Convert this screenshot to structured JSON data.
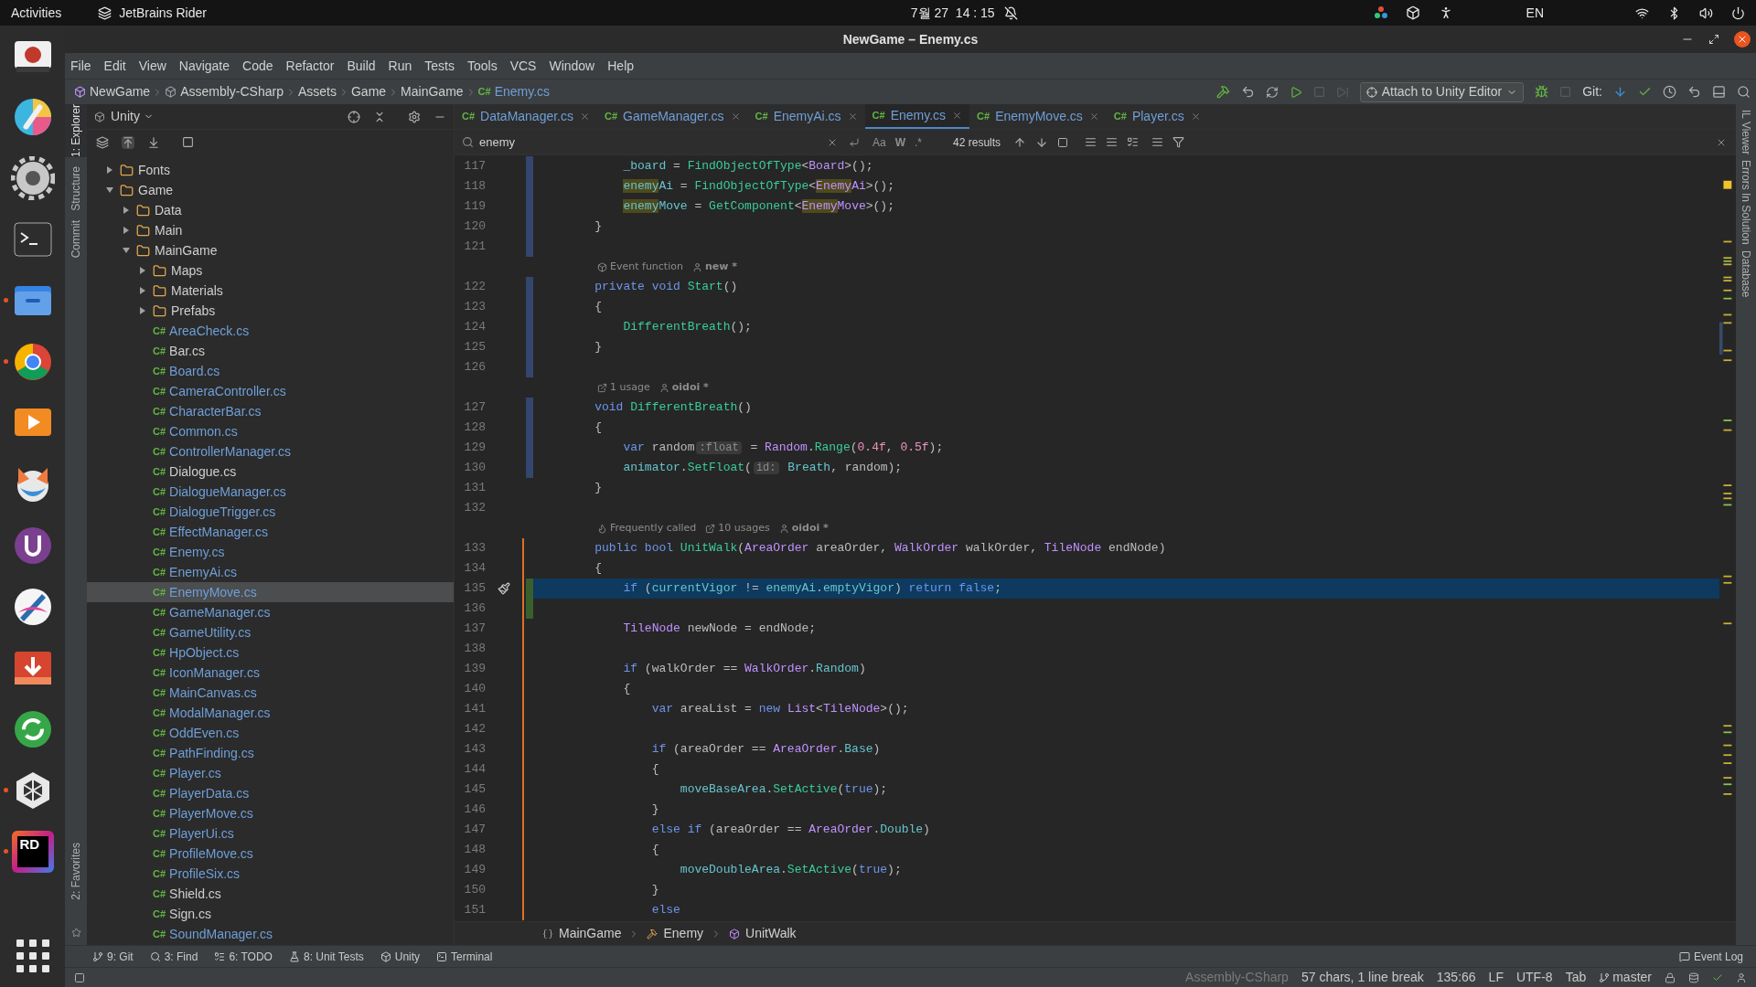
{
  "top_bar": {
    "activities": "Activities",
    "app_name": "JetBrains Rider",
    "clock": "7월 27  14 : 15",
    "language": "EN"
  },
  "dock": [
    {
      "kind": "screenshot",
      "running": false
    },
    {
      "kind": "colorpicker",
      "running": false
    },
    {
      "kind": "settings",
      "running": false
    },
    {
      "kind": "terminal",
      "running": false
    },
    {
      "kind": "files",
      "running": true
    },
    {
      "kind": "browser",
      "running": true
    },
    {
      "kind": "player",
      "running": false
    },
    {
      "kind": "fox",
      "running": false
    },
    {
      "kind": "ulauncher",
      "running": false
    },
    {
      "kind": "pen",
      "running": false
    },
    {
      "kind": "download",
      "running": false
    },
    {
      "kind": "sync",
      "running": false
    },
    {
      "kind": "unity",
      "running": true
    },
    {
      "kind": "rider",
      "running": true,
      "label": "RD"
    }
  ],
  "window": {
    "title": "NewGame – Enemy.cs"
  },
  "menu": [
    "File",
    "Edit",
    "View",
    "Navigate",
    "Code",
    "Refactor",
    "Build",
    "Run",
    "Tests",
    "Tools",
    "VCS",
    "Window",
    "Help"
  ],
  "nav_path": [
    {
      "label": "NewGame"
    },
    {
      "label": "Assembly-CSharp"
    },
    {
      "label": "Assets"
    },
    {
      "label": "Game"
    },
    {
      "label": "MainGame"
    },
    {
      "label": "Enemy.cs",
      "badge": "C#"
    }
  ],
  "run_config": "Attach to Unity Editor",
  "git_label": "Git:",
  "left_strip": [
    {
      "label": "1: Explorer",
      "selected": true
    },
    {
      "label": "Structure",
      "selected": false
    },
    {
      "label": "Commit",
      "selected": false
    }
  ],
  "left_strip_bottom": "2: Favorites",
  "project": {
    "view": "Unity",
    "tree": [
      {
        "name": "Fonts",
        "kind": "folder",
        "expanded": false,
        "selected": false
      },
      {
        "name": "Game",
        "kind": "folder",
        "expanded": true,
        "selected": false,
        "children": [
          {
            "name": "Data",
            "kind": "folder",
            "expanded": false,
            "selected": false
          },
          {
            "name": "Main",
            "kind": "folder",
            "expanded": false,
            "selected": false
          },
          {
            "name": "MainGame",
            "kind": "folder",
            "expanded": true,
            "selected": false,
            "children": [
              {
                "name": "Maps",
                "kind": "folder",
                "expanded": false,
                "selected": false
              },
              {
                "name": "Materials",
                "kind": "folder",
                "expanded": false,
                "selected": false
              },
              {
                "name": "Prefabs",
                "kind": "folder",
                "expanded": false,
                "selected": false
              },
              {
                "name": "AreaCheck.cs",
                "kind": "file",
                "badge": "C#",
                "modified": true,
                "selected": false
              },
              {
                "name": "Bar.cs",
                "kind": "file",
                "badge": "C#",
                "modified": false,
                "selected": false
              },
              {
                "name": "Board.cs",
                "kind": "file",
                "badge": "C#",
                "modified": true,
                "selected": false
              },
              {
                "name": "CameraController.cs",
                "kind": "file",
                "badge": "C#",
                "modified": true,
                "selected": false
              },
              {
                "name": "CharacterBar.cs",
                "kind": "file",
                "badge": "C#",
                "modified": true,
                "selected": false
              },
              {
                "name": "Common.cs",
                "kind": "file",
                "badge": "C#",
                "modified": true,
                "selected": false
              },
              {
                "name": "ControllerManager.cs",
                "kind": "file",
                "badge": "C#",
                "modified": true,
                "selected": false
              },
              {
                "name": "Dialogue.cs",
                "kind": "file",
                "badge": "C#",
                "modified": false,
                "selected": false
              },
              {
                "name": "DialogueManager.cs",
                "kind": "file",
                "badge": "C#",
                "modified": true,
                "selected": false
              },
              {
                "name": "DialogueTrigger.cs",
                "kind": "file",
                "badge": "C#",
                "modified": true,
                "selected": false
              },
              {
                "name": "EffectManager.cs",
                "kind": "file",
                "badge": "C#",
                "modified": true,
                "selected": false
              },
              {
                "name": "Enemy.cs",
                "kind": "file",
                "badge": "C#",
                "modified": true,
                "selected": false
              },
              {
                "name": "EnemyAi.cs",
                "kind": "file",
                "badge": "C#",
                "modified": true,
                "selected": false
              },
              {
                "name": "EnemyMove.cs",
                "kind": "file",
                "badge": "C#",
                "modified": true,
                "selected": true
              },
              {
                "name": "GameManager.cs",
                "kind": "file",
                "badge": "C#",
                "modified": true,
                "selected": false
              },
              {
                "name": "GameUtility.cs",
                "kind": "file",
                "badge": "C#",
                "modified": true,
                "selected": false
              },
              {
                "name": "HpObject.cs",
                "kind": "file",
                "badge": "C#",
                "modified": true,
                "selected": false
              },
              {
                "name": "IconManager.cs",
                "kind": "file",
                "badge": "C#",
                "modified": true,
                "selected": false
              },
              {
                "name": "MainCanvas.cs",
                "kind": "file",
                "badge": "C#",
                "modified": true,
                "selected": false
              },
              {
                "name": "ModalManager.cs",
                "kind": "file",
                "badge": "C#",
                "modified": true,
                "selected": false
              },
              {
                "name": "OddEven.cs",
                "kind": "file",
                "badge": "C#",
                "modified": true,
                "selected": false
              },
              {
                "name": "PathFinding.cs",
                "kind": "file",
                "badge": "C#",
                "modified": true,
                "selected": false
              },
              {
                "name": "Player.cs",
                "kind": "file",
                "badge": "C#",
                "modified": true,
                "selected": false
              },
              {
                "name": "PlayerData.cs",
                "kind": "file",
                "badge": "C#",
                "modified": true,
                "selected": false
              },
              {
                "name": "PlayerMove.cs",
                "kind": "file",
                "badge": "C#",
                "modified": true,
                "selected": false
              },
              {
                "name": "PlayerUi.cs",
                "kind": "file",
                "badge": "C#",
                "modified": true,
                "selected": false
              },
              {
                "name": "ProfileMove.cs",
                "kind": "file",
                "badge": "C#",
                "modified": true,
                "selected": false
              },
              {
                "name": "ProfileSix.cs",
                "kind": "file",
                "badge": "C#",
                "modified": true,
                "selected": false
              },
              {
                "name": "Shield.cs",
                "kind": "file",
                "badge": "C#",
                "modified": false,
                "selected": false
              },
              {
                "name": "Sign.cs",
                "kind": "file",
                "badge": "C#",
                "modified": false,
                "selected": false
              },
              {
                "name": "SoundManager.cs",
                "kind": "file",
                "badge": "C#",
                "modified": true,
                "selected": false
              }
            ]
          }
        ]
      }
    ]
  },
  "tabs": [
    {
      "badge": "C#",
      "label": "DataManager.cs",
      "selected": false
    },
    {
      "badge": "C#",
      "label": "GameManager.cs",
      "selected": false
    },
    {
      "badge": "C#",
      "label": "EnemyAi.cs",
      "selected": false
    },
    {
      "badge": "C#",
      "label": "Enemy.cs",
      "selected": true
    },
    {
      "badge": "C#",
      "label": "EnemyMove.cs",
      "selected": false
    },
    {
      "badge": "C#",
      "label": "Player.cs",
      "selected": false
    }
  ],
  "search": {
    "value": "enemy",
    "match_case": "Aa",
    "words": "W",
    "regex": ".*",
    "results": "42 results"
  },
  "code": [
    {
      "number": "117",
      "current": false,
      "modified": true,
      "tokens": [
        {
          "text": "        _board",
          "kind": "field"
        },
        {
          "text": " = ",
          "kind": "plain"
        },
        {
          "text": "FindObjectOfType",
          "kind": "method"
        },
        {
          "text": "<",
          "kind": "plain"
        },
        {
          "text": "Board",
          "kind": "type"
        },
        {
          "text": ">();",
          "kind": "plain"
        }
      ]
    },
    {
      "number": "118",
      "current": false,
      "modified": true,
      "tokens": [
        {
          "text": "        enemy",
          "kind": "field",
          "match": true
        },
        {
          "text": "Ai",
          "kind": "field"
        },
        {
          "text": " = ",
          "kind": "plain"
        },
        {
          "text": "FindObjectOfType",
          "kind": "method"
        },
        {
          "text": "<",
          "kind": "plain"
        },
        {
          "text": "Enemy",
          "kind": "type",
          "match": true
        },
        {
          "text": "Ai",
          "kind": "type"
        },
        {
          "text": ">();",
          "kind": "plain"
        }
      ]
    },
    {
      "number": "119",
      "current": false,
      "modified": true,
      "tokens": [
        {
          "text": "        enemy",
          "kind": "field",
          "match": true
        },
        {
          "text": "Move",
          "kind": "field"
        },
        {
          "text": " = ",
          "kind": "plain"
        },
        {
          "text": "GetComponent",
          "kind": "method"
        },
        {
          "text": "<",
          "kind": "plain"
        },
        {
          "text": "Enemy",
          "kind": "type",
          "match": true
        },
        {
          "text": "Move",
          "kind": "type"
        },
        {
          "text": ">();",
          "kind": "plain"
        }
      ]
    },
    {
      "number": "120",
      "current": false,
      "modified": true,
      "tokens": [
        {
          "text": "    }",
          "kind": "plain"
        }
      ]
    },
    {
      "number": "121",
      "current": false,
      "modified": true
    },
    {
      "hints": [
        {
          "kind": "unity",
          "text": "Event function"
        },
        {
          "kind": "author",
          "text": "new *"
        }
      ]
    },
    {
      "number": "122",
      "current": false,
      "modified": true,
      "tokens": [
        {
          "text": "    private void",
          "kind": "keyword"
        },
        {
          "text": " Start",
          "kind": "method"
        },
        {
          "text": "()",
          "kind": "plain"
        }
      ]
    },
    {
      "number": "123",
      "current": false,
      "modified": true,
      "tokens": [
        {
          "text": "    {",
          "kind": "plain"
        }
      ]
    },
    {
      "number": "124",
      "current": false,
      "modified": true,
      "tokens": [
        {
          "text": "        DifferentBreath",
          "kind": "method"
        },
        {
          "text": "();",
          "kind": "plain"
        }
      ]
    },
    {
      "number": "125",
      "current": false,
      "modified": true,
      "tokens": [
        {
          "text": "    }",
          "kind": "plain"
        }
      ]
    },
    {
      "number": "126",
      "current": false,
      "modified": true
    },
    {
      "hints": [
        {
          "kind": "usages",
          "text": "1 usage"
        },
        {
          "kind": "author",
          "text": "oidoi *"
        }
      ]
    },
    {
      "number": "127",
      "current": false,
      "modified": true,
      "tokens": [
        {
          "text": "    void",
          "kind": "keyword"
        },
        {
          "text": " DifferentBreath",
          "kind": "method"
        },
        {
          "text": "()",
          "kind": "plain"
        }
      ]
    },
    {
      "number": "128",
      "current": false,
      "modified": true,
      "tokens": [
        {
          "text": "    {",
          "kind": "plain"
        }
      ]
    },
    {
      "number": "129",
      "current": false,
      "modified": true,
      "tokens": [
        {
          "text": "        var",
          "kind": "keyword"
        },
        {
          "text": " random",
          "kind": "plain"
        },
        {
          "text": ":float",
          "kind": "hint"
        },
        {
          "text": " = ",
          "kind": "plain"
        },
        {
          "text": "Random",
          "kind": "type"
        },
        {
          "text": ".",
          "kind": "plain"
        },
        {
          "text": "Range",
          "kind": "method"
        },
        {
          "text": "(",
          "kind": "plain"
        },
        {
          "text": "0.4f",
          "kind": "number"
        },
        {
          "text": ", ",
          "kind": "plain"
        },
        {
          "text": "0.5f",
          "kind": "number"
        },
        {
          "text": ");",
          "kind": "plain"
        }
      ]
    },
    {
      "number": "130",
      "current": false,
      "modified": true,
      "tokens": [
        {
          "text": "        animator",
          "kind": "field"
        },
        {
          "text": ".",
          "kind": "plain"
        },
        {
          "text": "SetFloat",
          "kind": "method"
        },
        {
          "text": "(",
          "kind": "plain"
        },
        {
          "text": "id:",
          "kind": "hint"
        },
        {
          "text": " Breath",
          "kind": "member"
        },
        {
          "text": ", random);",
          "kind": "plain"
        }
      ]
    },
    {
      "number": "131",
      "current": false,
      "tokens": [
        {
          "text": "    }",
          "kind": "plain"
        }
      ]
    },
    {
      "number": "132",
      "current": false
    },
    {
      "hints": [
        {
          "kind": "fire",
          "text": "Frequently called"
        },
        {
          "kind": "usages",
          "text": "10 usages"
        },
        {
          "kind": "author",
          "text": "oidoi *"
        }
      ]
    },
    {
      "number": "133",
      "current": false,
      "bracket": true,
      "tokens": [
        {
          "text": "    public bool",
          "kind": "keyword"
        },
        {
          "text": " UnitWalk",
          "kind": "method"
        },
        {
          "text": "(",
          "kind": "plain"
        },
        {
          "text": "AreaOrder",
          "kind": "type"
        },
        {
          "text": " areaOrder, ",
          "kind": "plain"
        },
        {
          "text": "WalkOrder",
          "kind": "type"
        },
        {
          "text": " walkOrder, ",
          "kind": "plain"
        },
        {
          "text": "TileNode",
          "kind": "type"
        },
        {
          "text": " endNode)",
          "kind": "plain"
        }
      ]
    },
    {
      "number": "134",
      "current": false,
      "bracket": true,
      "tokens": [
        {
          "text": "    {",
          "kind": "plain"
        }
      ]
    },
    {
      "number": "135",
      "current": true,
      "bracket": true,
      "added": true,
      "action_icon": true,
      "tokens": [
        {
          "text": "        if",
          "kind": "keyword"
        },
        {
          "text": " (",
          "kind": "plain"
        },
        {
          "text": "currentVigor",
          "kind": "field"
        },
        {
          "text": " != ",
          "kind": "plain"
        },
        {
          "text": "enemyAi",
          "kind": "field"
        },
        {
          "text": ".",
          "kind": "plain"
        },
        {
          "text": "emptyVigor",
          "kind": "field"
        },
        {
          "text": ") ",
          "kind": "plain"
        },
        {
          "text": "return false",
          "kind": "keyword"
        },
        {
          "text": ";",
          "kind": "plain"
        }
      ]
    },
    {
      "number": "136",
      "current": false,
      "bracket": true,
      "added": true
    },
    {
      "number": "137",
      "current": false,
      "bracket": true,
      "tokens": [
        {
          "text": "        TileNode",
          "kind": "type"
        },
        {
          "text": " newNode = endNode;",
          "kind": "plain"
        }
      ]
    },
    {
      "number": "138",
      "current": false,
      "bracket": true
    },
    {
      "number": "139",
      "current": false,
      "bracket": true,
      "tokens": [
        {
          "text": "        if",
          "kind": "keyword"
        },
        {
          "text": " (walkOrder == ",
          "kind": "plain"
        },
        {
          "text": "WalkOrder",
          "kind": "type"
        },
        {
          "text": ".",
          "kind": "plain"
        },
        {
          "text": "Random",
          "kind": "member"
        },
        {
          "text": ")",
          "kind": "plain"
        }
      ]
    },
    {
      "number": "140",
      "current": false,
      "bracket": true,
      "tokens": [
        {
          "text": "        {",
          "kind": "plain"
        }
      ]
    },
    {
      "number": "141",
      "current": false,
      "bracket": true,
      "tokens": [
        {
          "text": "            var",
          "kind": "keyword"
        },
        {
          "text": " areaList = ",
          "kind": "plain"
        },
        {
          "text": "new",
          "kind": "keyword"
        },
        {
          "text": " List",
          "kind": "type"
        },
        {
          "text": "<",
          "kind": "plain"
        },
        {
          "text": "TileNode",
          "kind": "type"
        },
        {
          "text": ">();",
          "kind": "plain"
        }
      ]
    },
    {
      "number": "142",
      "current": false,
      "bracket": true
    },
    {
      "number": "143",
      "current": false,
      "bracket": true,
      "tokens": [
        {
          "text": "            if",
          "kind": "keyword"
        },
        {
          "text": " (areaOrder == ",
          "kind": "plain"
        },
        {
          "text": "AreaOrder",
          "kind": "type"
        },
        {
          "text": ".",
          "kind": "plain"
        },
        {
          "text": "Base",
          "kind": "member"
        },
        {
          "text": ")",
          "kind": "plain"
        }
      ]
    },
    {
      "number": "144",
      "current": false,
      "bracket": true,
      "tokens": [
        {
          "text": "            {",
          "kind": "plain"
        }
      ]
    },
    {
      "number": "145",
      "current": false,
      "bracket": true,
      "tokens": [
        {
          "text": "                moveBaseArea",
          "kind": "field"
        },
        {
          "text": ".",
          "kind": "plain"
        },
        {
          "text": "SetActive",
          "kind": "method"
        },
        {
          "text": "(",
          "kind": "plain"
        },
        {
          "text": "true",
          "kind": "keyword"
        },
        {
          "text": ");",
          "kind": "plain"
        }
      ]
    },
    {
      "number": "146",
      "current": false,
      "bracket": true,
      "tokens": [
        {
          "text": "            }",
          "kind": "plain"
        }
      ]
    },
    {
      "number": "147",
      "current": false,
      "bracket": true,
      "tokens": [
        {
          "text": "            else if",
          "kind": "keyword"
        },
        {
          "text": " (areaOrder == ",
          "kind": "plain"
        },
        {
          "text": "AreaOrder",
          "kind": "type"
        },
        {
          "text": ".",
          "kind": "plain"
        },
        {
          "text": "Double",
          "kind": "member"
        },
        {
          "text": ")",
          "kind": "plain"
        }
      ]
    },
    {
      "number": "148",
      "current": false,
      "bracket": true,
      "tokens": [
        {
          "text": "            {",
          "kind": "plain"
        }
      ]
    },
    {
      "number": "149",
      "current": false,
      "bracket": true,
      "tokens": [
        {
          "text": "                moveDoubleArea",
          "kind": "field"
        },
        {
          "text": ".",
          "kind": "plain"
        },
        {
          "text": "SetActive",
          "kind": "method"
        },
        {
          "text": "(",
          "kind": "plain"
        },
        {
          "text": "true",
          "kind": "keyword"
        },
        {
          "text": ");",
          "kind": "plain"
        }
      ]
    },
    {
      "number": "150",
      "current": false,
      "bracket": true,
      "tokens": [
        {
          "text": "            }",
          "kind": "plain"
        }
      ]
    },
    {
      "number": "151",
      "current": false,
      "bracket": true,
      "tokens": [
        {
          "text": "            else",
          "kind": "keyword"
        }
      ]
    }
  ],
  "breadcrumbs": [
    {
      "kind": "namespace",
      "label": "MainGame"
    },
    {
      "kind": "class",
      "label": "Enemy"
    },
    {
      "kind": "method",
      "label": "UnitWalk"
    }
  ],
  "right_strip": [
    "IL Viewer",
    "Errors In Solution",
    "Database"
  ],
  "tool_windows": [
    {
      "kind": "git",
      "label": "9: Git"
    },
    {
      "kind": "find",
      "label": "3: Find"
    },
    {
      "kind": "todo",
      "label": "6: TODO"
    },
    {
      "kind": "tests",
      "label": "8: Unit Tests"
    },
    {
      "kind": "unity",
      "label": "Unity"
    },
    {
      "kind": "terminal",
      "label": "Terminal"
    }
  ],
  "event_log": "Event Log",
  "status_bar": {
    "project": "Assembly-CSharp",
    "selection": "57 chars, 1 line break",
    "position": "135:66",
    "line_ending": "LF",
    "encoding": "UTF-8",
    "indent": "Tab",
    "branch": "master"
  }
}
